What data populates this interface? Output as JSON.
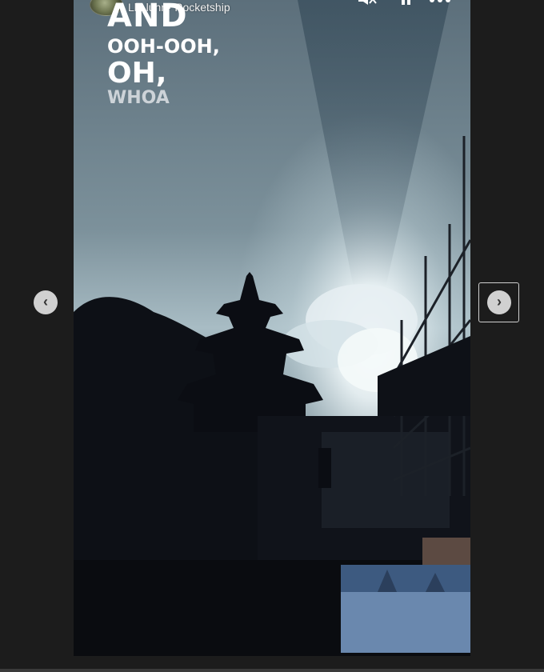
{
  "story": {
    "music_icon": "music-bars-icon",
    "music_text": "Ll  Llunr · Rocketship"
  },
  "lyrics": {
    "line1": "AND",
    "line2": "OOH-OOH,",
    "line3": "OH,",
    "line4": "WHOA"
  },
  "controls": {
    "mute_icon": "speaker-muted-icon",
    "pause_icon": "pause-icon",
    "more_icon": "more-icon",
    "prev_icon": "chevron-left-icon",
    "next_icon": "chevron-right-icon"
  },
  "colors": {
    "page_background": "#1c1c1c",
    "sky_top": "#5f7380",
    "sky_glow": "#e9f4f8",
    "silhouette": "#0b0d13"
  }
}
